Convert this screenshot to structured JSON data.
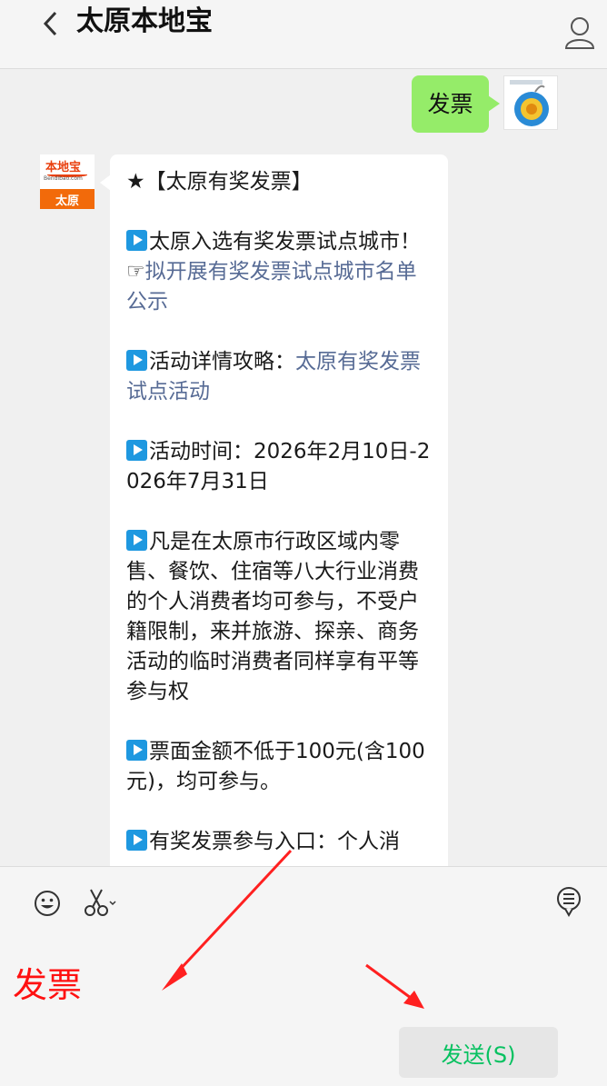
{
  "header": {
    "title": "太原本地宝",
    "back_icon": "chevron-left-icon",
    "profile_icon": "person-icon"
  },
  "chat": {
    "my_message": "发票",
    "bot_avatar": {
      "brand": "本地宝",
      "url": "Bendibao.com",
      "city": "太原"
    },
    "bot_message": {
      "heading": "★【太原有奖发票】",
      "item1_text": "太原入选有奖发票试点城市！☞",
      "item1_link": "拟开展有奖发票试点城市名单公示",
      "item2_text": "活动详情攻略：",
      "item2_link": "太原有奖发票试点活动",
      "item3_text": "活动时间：2026年2月10日-2026年7月31日",
      "item4_text": "凡是在太原市行政区域内零售、餐饮、住宿等八大行业消费的个人消费者均可参与，不受户籍限制，来并旅游、探亲、商务活动的临时消费者同样享有平等参与权",
      "item5_text": "票面金额不低于100元(含100元)，均可参与。",
      "item6_text": "有奖发票参与入口：个人消"
    }
  },
  "input": {
    "typed_text": "发票",
    "send_label": "发送(S)",
    "icons": [
      "emoji-icon",
      "scissors-icon",
      "chat-history-icon"
    ]
  },
  "colors": {
    "accent_green": "#95ec69",
    "send_text": "#07c160",
    "link": "#576b95",
    "annotation_red": "#ff1111"
  }
}
